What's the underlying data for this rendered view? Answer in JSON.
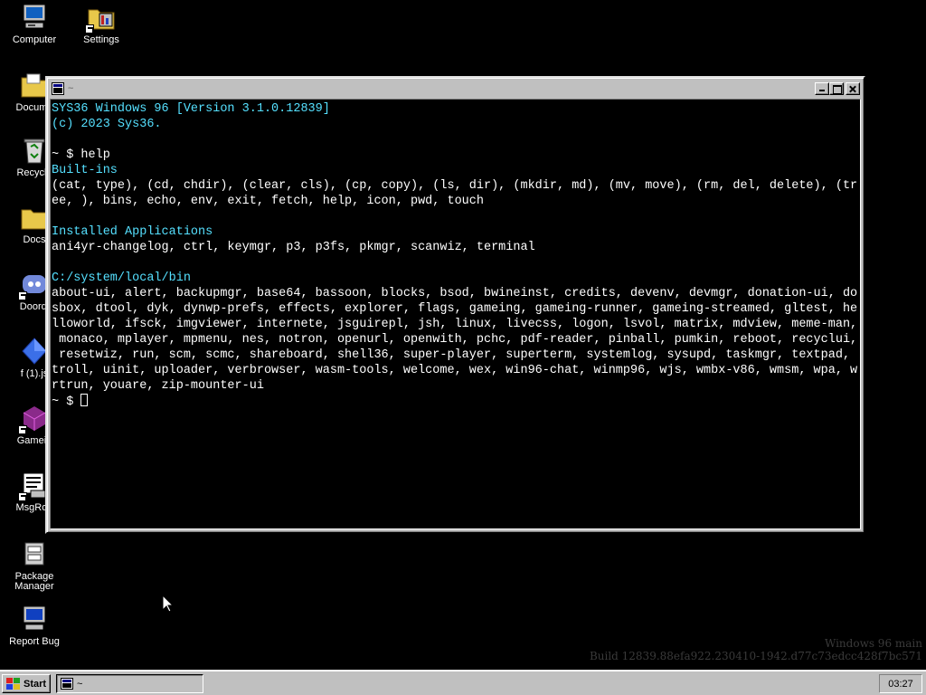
{
  "desktop": {
    "icons": [
      {
        "label": "Computer",
        "icon": "computer-icon"
      },
      {
        "label": "Settings",
        "icon": "settings-icon"
      },
      {
        "label": "Docume",
        "icon": "documents-folder-icon"
      },
      {
        "label": "Recycle",
        "icon": "recycle-bin-icon"
      },
      {
        "label": "Docs",
        "icon": "docs-folder-icon"
      },
      {
        "label": "Doordi",
        "icon": "discord-icon"
      },
      {
        "label": "f (1).js",
        "icon": "js-file-icon"
      },
      {
        "label": "Gamein",
        "icon": "gameing-icon"
      },
      {
        "label": "MsgRoo",
        "icon": "msgroom-icon"
      },
      {
        "label": "Package Manager",
        "icon": "package-manager-icon"
      },
      {
        "label": "Report Bug",
        "icon": "report-bug-icon"
      }
    ]
  },
  "window": {
    "title": "~"
  },
  "terminal": {
    "lines": [
      {
        "text": "SYS36 Windows 96 [Version 3.1.0.12839]",
        "color": "cyan"
      },
      {
        "text": "(c) 2023 Sys36.",
        "color": "cyan"
      },
      {
        "text": "",
        "color": "white"
      },
      {
        "text": "~ $ help",
        "color": "white"
      },
      {
        "text": "Built-ins",
        "color": "cyan"
      },
      {
        "text": "(cat, type), (cd, chdir), (clear, cls), (cp, copy), (ls, dir), (mkdir, md), (mv, move), (rm, del, delete), (tr",
        "color": "white"
      },
      {
        "text": "ee, ), bins, echo, env, exit, fetch, help, icon, pwd, touch",
        "color": "white"
      },
      {
        "text": "",
        "color": "white"
      },
      {
        "text": "Installed Applications",
        "color": "cyan"
      },
      {
        "text": "ani4yr-changelog, ctrl, keymgr, p3, p3fs, pkmgr, scanwiz, terminal",
        "color": "white"
      },
      {
        "text": "",
        "color": "white"
      },
      {
        "text": "C:/system/local/bin",
        "color": "cyan"
      },
      {
        "text": "about-ui, alert, backupmgr, base64, bassoon, blocks, bsod, bwineinst, credits, devenv, devmgr, donation-ui, do",
        "color": "white"
      },
      {
        "text": "sbox, dtool, dyk, dynwp-prefs, effects, explorer, flags, gameing, gameing-runner, gameing-streamed, gltest, he",
        "color": "white"
      },
      {
        "text": "lloworld, ifsck, imgviewer, internete, jsguirepl, jsh, linux, livecss, logon, lsvol, matrix, mdview, meme-man,",
        "color": "white"
      },
      {
        "text": " monaco, mplayer, mpmenu, nes, notron, openurl, openwith, pchc, pdf-reader, pinball, pumkin, reboot, recyclui,",
        "color": "white"
      },
      {
        "text": " resetwiz, run, scm, scmc, shareboard, shell36, super-player, superterm, systemlog, sysupd, taskmgr, textpad,",
        "color": "white"
      },
      {
        "text": "troll, uinit, uploader, verbrowser, wasm-tools, welcome, wex, win96-chat, winmp96, wjs, wmbx-v86, wmsm, wpa, w",
        "color": "white"
      },
      {
        "text": "rtrun, youare, zip-mounter-ui",
        "color": "white"
      }
    ],
    "prompt": "~ $ "
  },
  "watermark": {
    "line1": "Windows 96 main",
    "line2": "Build 12839.88efa922.230410-1942.d77c73edcc428f7bc571"
  },
  "taskbar": {
    "start_label": "Start",
    "task_title": "~",
    "clock": "03:27"
  },
  "colors": {
    "cyan": "#55e0ff",
    "desktop_bg": "#000000",
    "chrome": "#c0c0c0"
  }
}
